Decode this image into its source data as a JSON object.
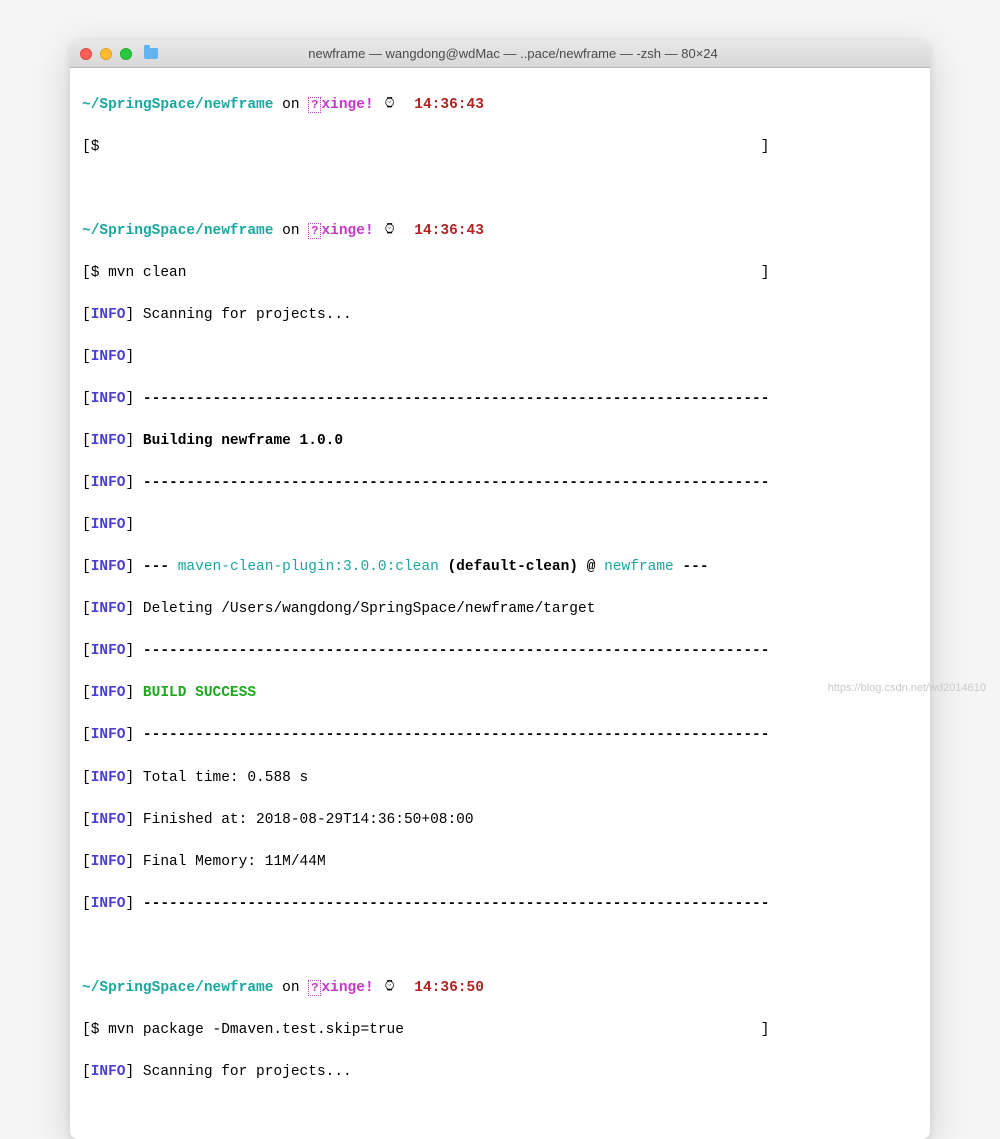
{
  "window": {
    "title": "newframe — wangdong@wdMac — ..pace/newframe — -zsh — 80×24"
  },
  "prompt": {
    "cwd": "~/SpringSpace/newframe",
    "on": " on ",
    "branch_pre": "?",
    "branch": "xinge!",
    "watch": "⌚︎",
    "time1": "14:36:43",
    "time2": "14:36:43",
    "time3": "14:36:50",
    "ps1_open": "[",
    "ps1_close": "]",
    "ps1": "$"
  },
  "cmd": {
    "empty": "",
    "clean": " mvn clean",
    "package": " mvn package -Dmaven.test.skip=true"
  },
  "info": {
    "label": "INFO",
    "lb": "[",
    "rb": "]"
  },
  "lines": {
    "scanning": " Scanning for projects...",
    "dashes": " ------------------------------------------------------------------------",
    "building": " Building newframe 1.0.0",
    "plugin_pre": " --- ",
    "plugin": "maven-clean-plugin:3.0.0:clean",
    "plugin_goal": " (default-clean) @ ",
    "artifact": "newframe",
    "plugin_post": " ---",
    "deleting": " Deleting /Users/wangdong/SpringSpace/newframe/target",
    "build_success": " BUILD SUCCESS",
    "total_time": " Total time: 0.588 s",
    "finished": " Finished at: 2018-08-29T14:36:50+08:00",
    "memory": " Final Memory: 11M/44M"
  },
  "watermark": "https://blog.csdn.net/wd2014610"
}
